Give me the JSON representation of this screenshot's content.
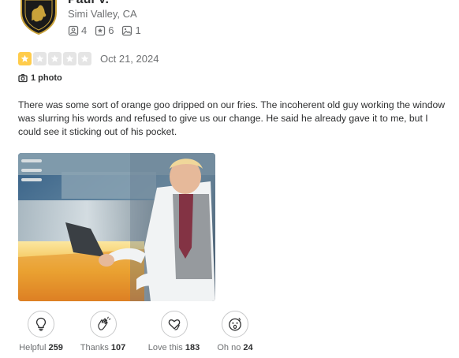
{
  "reviewer": {
    "name": "Paul V.",
    "location": "Simi Valley, CA",
    "stats": {
      "friends": "4",
      "reviews": "6",
      "photos": "1"
    },
    "avatar_icon": "lamborghini-shield-logo"
  },
  "review": {
    "rating": 1,
    "max_rating": 5,
    "star_color": "#ffcc4b",
    "empty_star_color": "#e5e5e5",
    "date": "Oct 21, 2024",
    "photo_count_label": "1 photo",
    "text": "There was some sort of orange goo dripped on our fries. The incoherent old guy working the window was slurring his words and refused to give us our change. He said he already gave it to me, but I could see it sticking out of his pocket."
  },
  "reactions": [
    {
      "label": "Helpful",
      "count": "259",
      "icon": "lightbulb-icon"
    },
    {
      "label": "Thanks",
      "count": "107",
      "icon": "clapping-hands-icon"
    },
    {
      "label": "Love this",
      "count": "183",
      "icon": "heart-hands-icon"
    },
    {
      "label": "Oh no",
      "count": "24",
      "icon": "shocked-face-icon"
    }
  ]
}
